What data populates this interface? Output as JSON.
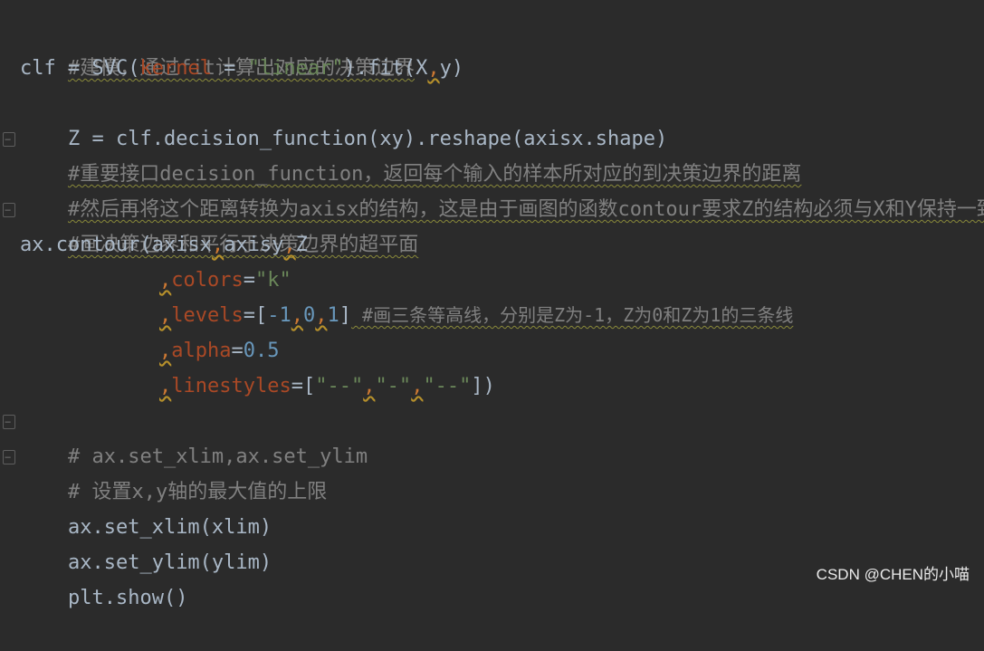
{
  "code": {
    "l1": "#建模，通过fit计算出对应的决策边界",
    "l2_a": "clf = SVC(",
    "l2_b": "kernel",
    "l2_c": " = ",
    "l2_d": "\"linear\"",
    "l2_e": ").fit(X",
    "l2_f": ",",
    "l2_g": "y)",
    "l3": "Z = clf.decision_function(xy).reshape(axisx.shape)",
    "l4": "#重要接口decision_function，返回每个输入的样本所对应的到决策边界的距离",
    "l5": "#然后再将这个距离转换为axisx的结构，这是由于画图的函数contour要求Z的结构必须与X和Y保持一致",
    "l6": "#画决策边界和平行于决策边界的超平面",
    "l7_a": "ax.contour(axisx",
    "l7_b": ",",
    "l7_c": "axisy",
    "l7_d": ",",
    "l7_e": "Z",
    "l8_comma": ",",
    "l8_kw": "colors",
    "l8_eq": "=",
    "l8_val": "\"k\"",
    "l9_comma": ",",
    "l9_kw": "levels",
    "l9_eq": "=[",
    "l9_n1": "-1",
    "l9_c1": ",",
    "l9_n2": "0",
    "l9_c2": ",",
    "l9_n3": "1",
    "l9_close": "]",
    "l9_comment": " #画三条等高线，分别是Z为-1，Z为0和Z为1的三条线",
    "l10_comma": ",",
    "l10_kw": "alpha",
    "l10_eq": "=",
    "l10_val": "0.5",
    "l11_comma": ",",
    "l11_kw": "linestyles",
    "l11_eq": "=[",
    "l11_s1": "\"--\"",
    "l11_c1": ",",
    "l11_s2": "\"-\"",
    "l11_c2": ",",
    "l11_s3": "\"--\"",
    "l11_close": "])",
    "l12": "# ax.set_xlim,ax.set_ylim",
    "l13": "# 设置x,y轴的最大值的上限",
    "l14": "ax.set_xlim(xlim)",
    "l15": "ax.set_ylim(ylim)",
    "l16": "plt.show()"
  },
  "watermark": "CSDN @CHEN的小喵",
  "colors": {
    "background": "#2b2b2b",
    "default_text": "#a9b7c6",
    "comment": "#808080",
    "string": "#6a8759",
    "parameter": "#aa4926",
    "number": "#6897bb",
    "punctuation": "#cc7832"
  }
}
